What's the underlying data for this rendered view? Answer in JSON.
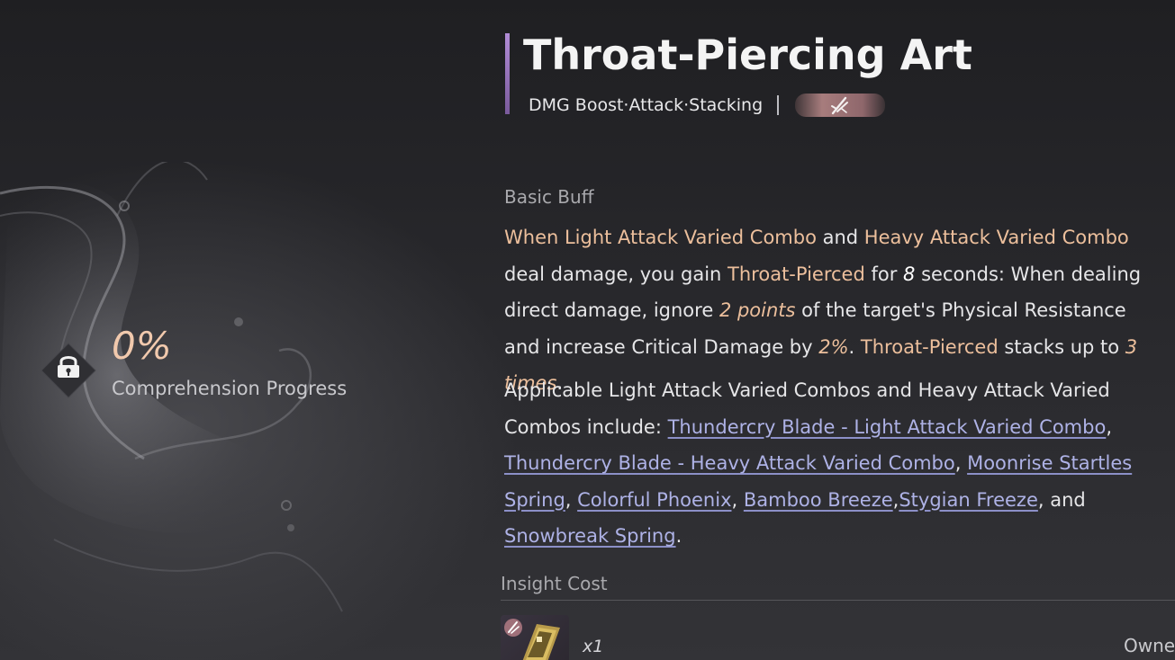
{
  "header": {
    "title": "Throat-Piercing Art",
    "subtitle": "DMG Boost·Attack·Stacking",
    "weapon_icon": "crossed-swords-icon"
  },
  "progress": {
    "value": "0%",
    "label": "Comprehension Progress",
    "icon": "lock-emblem-icon"
  },
  "basic_buff": {
    "label": "Basic Buff",
    "parts": [
      {
        "t": "When Light Attack Varied Combo",
        "k": "hl"
      },
      {
        "t": " and ",
        "k": ""
      },
      {
        "t": "Heavy Attack Varied Combo",
        "k": "hl"
      },
      {
        "t": " deal damage, you gain ",
        "k": ""
      },
      {
        "t": "Throat-Pierced",
        "k": "hl"
      },
      {
        "t": " for ",
        "k": ""
      },
      {
        "t": "8",
        "k": "num-white"
      },
      {
        "t": " seconds: When dealing direct damage, ignore ",
        "k": ""
      },
      {
        "t": "2 points",
        "k": "num"
      },
      {
        "t": " of the target's Physical Resistance and increase Critical Damage by ",
        "k": ""
      },
      {
        "t": "2%",
        "k": "num"
      },
      {
        "t": ". ",
        "k": ""
      },
      {
        "t": "Throat-Pierced",
        "k": "hl"
      },
      {
        "t": " stacks up to ",
        "k": ""
      },
      {
        "t": "3 times",
        "k": "num"
      },
      {
        "t": ".",
        "k": ""
      }
    ]
  },
  "applicable": {
    "parts": [
      {
        "t": "Applicable Light Attack Varied Combos and Heavy Attack Varied Combos include: ",
        "k": ""
      },
      {
        "t": "Thundercry Blade - Light Attack Varied Combo",
        "k": "lnk"
      },
      {
        "t": ", ",
        "k": ""
      },
      {
        "t": "Thundercry Blade - Heavy Attack Varied Combo",
        "k": "lnk"
      },
      {
        "t": ", ",
        "k": ""
      },
      {
        "t": "Moonrise Startles Spring",
        "k": "lnk"
      },
      {
        "t": ", ",
        "k": ""
      },
      {
        "t": "Colorful Phoenix",
        "k": "lnk"
      },
      {
        "t": ", ",
        "k": ""
      },
      {
        "t": "Bamboo Breeze",
        "k": "lnk"
      },
      {
        "t": ",",
        "k": ""
      },
      {
        "t": "Stygian Freeze",
        "k": "lnk"
      },
      {
        "t": ", and ",
        "k": ""
      },
      {
        "t": "Snowbreak Spring",
        "k": "lnk"
      },
      {
        "t": ".",
        "k": ""
      }
    ]
  },
  "insight_cost": {
    "label": "Insight Cost",
    "item_icon": "insight-scroll-icon",
    "quantity": "x1",
    "owned_label": "Owne"
  },
  "colors": {
    "highlight": "#ecbf9c",
    "link": "#aeb2e6",
    "title_bar": "#b18cd6"
  }
}
